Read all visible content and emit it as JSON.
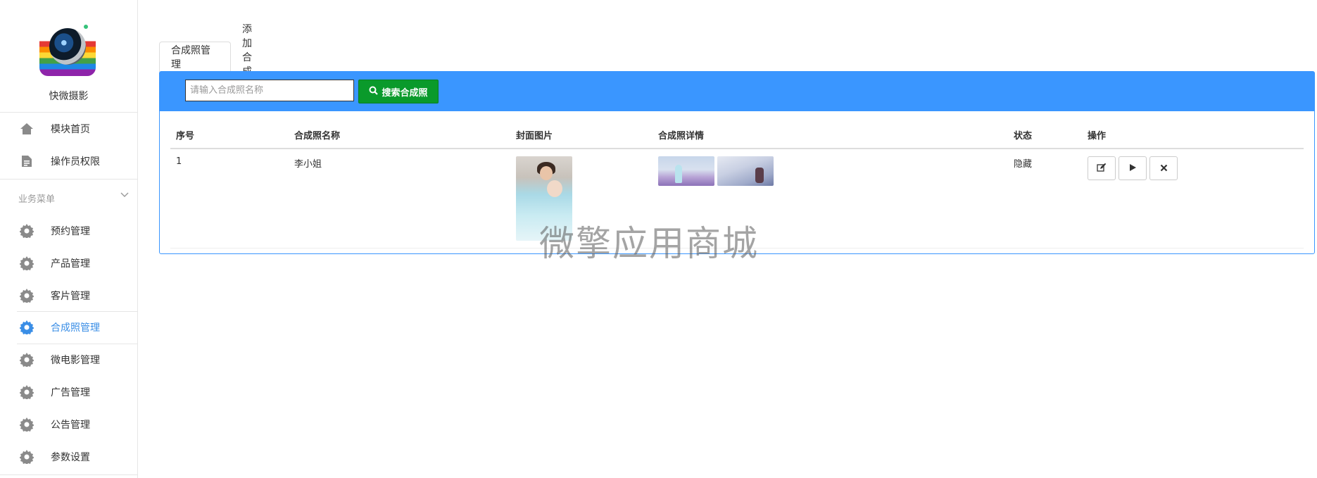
{
  "app": {
    "name": "快微摄影"
  },
  "sidebar": {
    "top_items": [
      {
        "label": "模块首页",
        "icon": "home-icon"
      },
      {
        "label": "操作员权限",
        "icon": "document-icon"
      }
    ],
    "section": {
      "title": "业务菜单"
    },
    "items": [
      {
        "label": "预约管理",
        "icon": "gear-icon"
      },
      {
        "label": "产品管理",
        "icon": "gear-icon"
      },
      {
        "label": "客片管理",
        "icon": "gear-icon"
      },
      {
        "label": "合成照管理",
        "icon": "gear-icon",
        "active": true
      },
      {
        "label": "微电影管理",
        "icon": "gear-icon"
      },
      {
        "label": "广告管理",
        "icon": "gear-icon"
      },
      {
        "label": "公告管理",
        "icon": "gear-icon"
      },
      {
        "label": "参数设置",
        "icon": "gear-icon"
      }
    ]
  },
  "tabs": [
    {
      "label": "合成照管理",
      "active": true
    },
    {
      "label": "添加合成照",
      "active": false
    }
  ],
  "search": {
    "placeholder": "请输入合成照名称",
    "value": "",
    "button_label": "搜索合成照"
  },
  "table": {
    "headers": {
      "index": "序号",
      "name": "合成照名称",
      "cover": "封面图片",
      "details": "合成照详情",
      "status": "状态",
      "actions": "操作"
    },
    "rows": [
      {
        "index": "1",
        "name": "李小姐",
        "status": "隐藏"
      }
    ]
  },
  "watermark": "微擎应用商城",
  "colors": {
    "accent": "#3a96ff",
    "search_button": "#0a9a2b",
    "active_nav": "#3a8ee6"
  }
}
